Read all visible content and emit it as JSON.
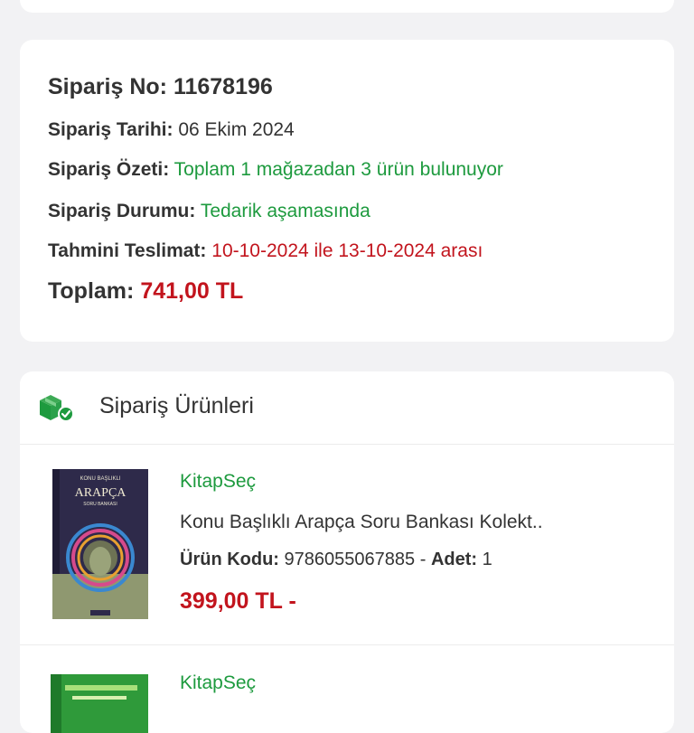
{
  "order": {
    "number_label": "Sipariş No:",
    "number": "11678196",
    "date_label": "Sipariş Tarihi:",
    "date": "06 Ekim 2024",
    "summary_label": "Sipariş Özeti:",
    "summary": "Toplam 1 mağazadan 3 ürün bulunuyor",
    "status_label": "Sipariş Durumu:",
    "status": "Tedarik aşamasında",
    "delivery_label": "Tahmini Teslimat:",
    "delivery": "10-10-2024 ile 13-10-2024 arası",
    "total_label": "Toplam:",
    "total": "741,00 TL"
  },
  "products": {
    "title": "Sipariş Ürünleri",
    "icon": "package-check-icon",
    "items": [
      {
        "store": "KitapSeç",
        "name": "Konu Başlıklı Arapça Soru Bankası Kolekt..",
        "code_label": "Ürün Kodu:",
        "code": "9786055067885",
        "separator": "-",
        "qty_label": "Adet:",
        "qty": "1",
        "price": "399,00 TL -",
        "cover_title": "ARAPÇA",
        "cover_top": "KONU BAŞLIKLI",
        "cover_sub": "SORU BANKASI"
      },
      {
        "store": "KitapSeç"
      }
    ]
  },
  "colors": {
    "accent_green": "#1d9a3e",
    "price_red": "#c2141d",
    "background": "#f2f2f4"
  }
}
